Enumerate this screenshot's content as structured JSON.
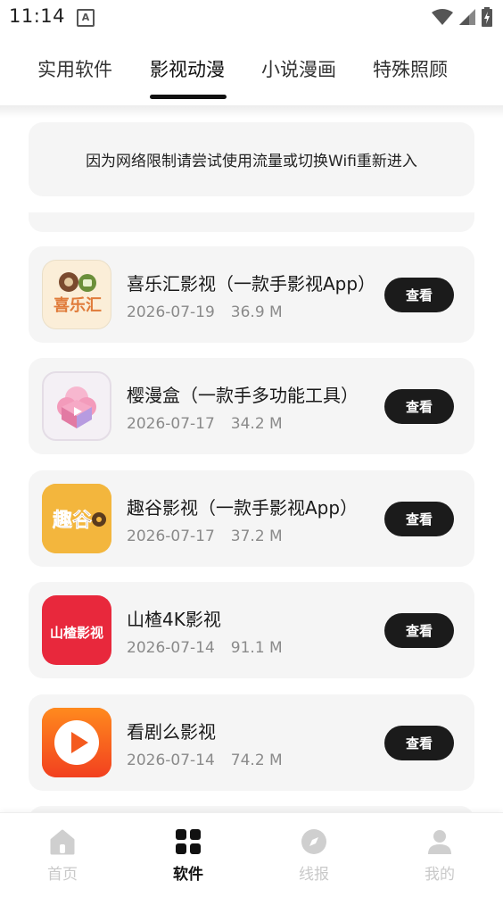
{
  "status_bar": {
    "time": "11:14",
    "notification_icon": "A"
  },
  "tabs": [
    {
      "label": "实用软件",
      "active": false
    },
    {
      "label": "影视动漫",
      "active": true
    },
    {
      "label": "小说漫画",
      "active": false
    },
    {
      "label": "特殊照顾",
      "active": false
    }
  ],
  "notice": "因为网络限制请尝试使用流量或切换Wifi重新进入",
  "apps": [
    {
      "name": "喜乐汇影视（一款手影视App）",
      "date": "2026-07-19",
      "size": "36.9 M",
      "button": "查看",
      "icon_text": "喜乐汇",
      "icon": "xilehui-icon"
    },
    {
      "name": "樱漫盒（一款手多功能工具）",
      "date": "2026-07-17",
      "size": "34.2 M",
      "button": "查看",
      "icon": "yingmanhe-icon"
    },
    {
      "name": "趣谷影视（一款手影视App）",
      "date": "2026-07-17",
      "size": "37.2 M",
      "button": "查看",
      "icon_text": "趣谷",
      "icon": "qugu-icon"
    },
    {
      "name": "山楂4K影视",
      "date": "2026-07-14",
      "size": "91.1 M",
      "button": "查看",
      "icon_text": "山楂影视",
      "icon": "shanzha-icon"
    },
    {
      "name": "看剧么影视",
      "date": "2026-07-14",
      "size": "74.2 M",
      "button": "查看",
      "icon": "play-icon"
    }
  ],
  "bottom_nav": [
    {
      "label": "首页",
      "icon": "home-icon",
      "active": false
    },
    {
      "label": "软件",
      "icon": "grid-icon",
      "active": true
    },
    {
      "label": "线报",
      "icon": "compass-icon",
      "active": false
    },
    {
      "label": "我的",
      "icon": "user-icon",
      "active": false
    }
  ],
  "colors": {
    "active": "#111111",
    "inactive": "#c9c9c9",
    "card_bg": "#f5f5f5",
    "button_bg": "#1b1b1b"
  }
}
